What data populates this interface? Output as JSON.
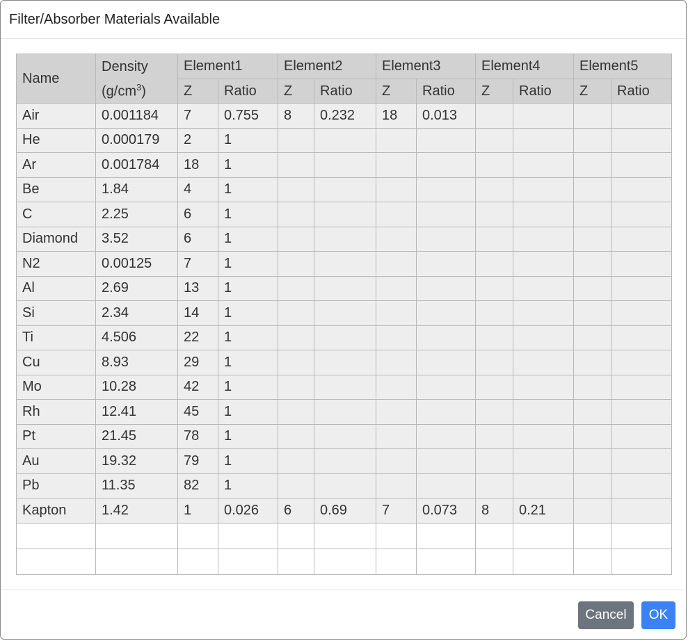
{
  "dialog": {
    "title": "Filter/Absorber Materials Available",
    "cancel_label": "Cancel",
    "ok_label": "OK"
  },
  "table": {
    "headers": {
      "name": "Name",
      "density": "Density",
      "density_unit_pre": "(g/cm",
      "density_unit_sup": "3",
      "density_unit_post": ")",
      "elements": [
        "Element1",
        "Element2",
        "Element3",
        "Element4",
        "Element5"
      ],
      "z": "Z",
      "ratio": "Ratio"
    },
    "rows": [
      {
        "name": "Air",
        "density": "0.001184",
        "elements": [
          [
            "7",
            "0.755"
          ],
          [
            "8",
            "0.232"
          ],
          [
            "18",
            "0.013"
          ],
          [
            "",
            ""
          ],
          [
            "",
            ""
          ]
        ]
      },
      {
        "name": "He",
        "density": "0.000179",
        "elements": [
          [
            "2",
            "1"
          ],
          [
            "",
            ""
          ],
          [
            "",
            ""
          ],
          [
            "",
            ""
          ],
          [
            "",
            ""
          ]
        ]
      },
      {
        "name": "Ar",
        "density": "0.001784",
        "elements": [
          [
            "18",
            "1"
          ],
          [
            "",
            ""
          ],
          [
            "",
            ""
          ],
          [
            "",
            ""
          ],
          [
            "",
            ""
          ]
        ]
      },
      {
        "name": "Be",
        "density": "1.84",
        "elements": [
          [
            "4",
            "1"
          ],
          [
            "",
            ""
          ],
          [
            "",
            ""
          ],
          [
            "",
            ""
          ],
          [
            "",
            ""
          ]
        ]
      },
      {
        "name": "C",
        "density": "2.25",
        "elements": [
          [
            "6",
            "1"
          ],
          [
            "",
            ""
          ],
          [
            "",
            ""
          ],
          [
            "",
            ""
          ],
          [
            "",
            ""
          ]
        ]
      },
      {
        "name": "Diamond",
        "density": "3.52",
        "elements": [
          [
            "6",
            "1"
          ],
          [
            "",
            ""
          ],
          [
            "",
            ""
          ],
          [
            "",
            ""
          ],
          [
            "",
            ""
          ]
        ]
      },
      {
        "name": "N2",
        "density": "0.00125",
        "elements": [
          [
            "7",
            "1"
          ],
          [
            "",
            ""
          ],
          [
            "",
            ""
          ],
          [
            "",
            ""
          ],
          [
            "",
            ""
          ]
        ]
      },
      {
        "name": "Al",
        "density": "2.69",
        "elements": [
          [
            "13",
            "1"
          ],
          [
            "",
            ""
          ],
          [
            "",
            ""
          ],
          [
            "",
            ""
          ],
          [
            "",
            ""
          ]
        ]
      },
      {
        "name": "Si",
        "density": "2.34",
        "elements": [
          [
            "14",
            "1"
          ],
          [
            "",
            ""
          ],
          [
            "",
            ""
          ],
          [
            "",
            ""
          ],
          [
            "",
            ""
          ]
        ]
      },
      {
        "name": "Ti",
        "density": "4.506",
        "elements": [
          [
            "22",
            "1"
          ],
          [
            "",
            ""
          ],
          [
            "",
            ""
          ],
          [
            "",
            ""
          ],
          [
            "",
            ""
          ]
        ]
      },
      {
        "name": "Cu",
        "density": "8.93",
        "elements": [
          [
            "29",
            "1"
          ],
          [
            "",
            ""
          ],
          [
            "",
            ""
          ],
          [
            "",
            ""
          ],
          [
            "",
            ""
          ]
        ]
      },
      {
        "name": "Mo",
        "density": "10.28",
        "elements": [
          [
            "42",
            "1"
          ],
          [
            "",
            ""
          ],
          [
            "",
            ""
          ],
          [
            "",
            ""
          ],
          [
            "",
            ""
          ]
        ]
      },
      {
        "name": "Rh",
        "density": "12.41",
        "elements": [
          [
            "45",
            "1"
          ],
          [
            "",
            ""
          ],
          [
            "",
            ""
          ],
          [
            "",
            ""
          ],
          [
            "",
            ""
          ]
        ]
      },
      {
        "name": "Pt",
        "density": "21.45",
        "elements": [
          [
            "78",
            "1"
          ],
          [
            "",
            ""
          ],
          [
            "",
            ""
          ],
          [
            "",
            ""
          ],
          [
            "",
            ""
          ]
        ]
      },
      {
        "name": "Au",
        "density": "19.32",
        "elements": [
          [
            "79",
            "1"
          ],
          [
            "",
            ""
          ],
          [
            "",
            ""
          ],
          [
            "",
            ""
          ],
          [
            "",
            ""
          ]
        ]
      },
      {
        "name": "Pb",
        "density": "11.35",
        "elements": [
          [
            "82",
            "1"
          ],
          [
            "",
            ""
          ],
          [
            "",
            ""
          ],
          [
            "",
            ""
          ],
          [
            "",
            ""
          ]
        ]
      },
      {
        "name": "Kapton",
        "density": "1.42",
        "elements": [
          [
            "1",
            "0.026"
          ],
          [
            "6",
            "0.69"
          ],
          [
            "7",
            "0.073"
          ],
          [
            "8",
            "0.21"
          ],
          [
            "",
            ""
          ]
        ]
      },
      {
        "name": "",
        "density": "",
        "elements": [
          [
            "",
            ""
          ],
          [
            "",
            ""
          ],
          [
            "",
            ""
          ],
          [
            "",
            ""
          ],
          [
            "",
            ""
          ]
        ]
      },
      {
        "name": "",
        "density": "",
        "elements": [
          [
            "",
            ""
          ],
          [
            "",
            ""
          ],
          [
            "",
            ""
          ],
          [
            "",
            ""
          ],
          [
            "",
            ""
          ]
        ]
      }
    ]
  },
  "colors": {
    "header_bg": "#d2d2d2",
    "row_bg": "#eeeeee",
    "cancel_bg": "#6c757d",
    "ok_bg": "#3b82f6"
  }
}
